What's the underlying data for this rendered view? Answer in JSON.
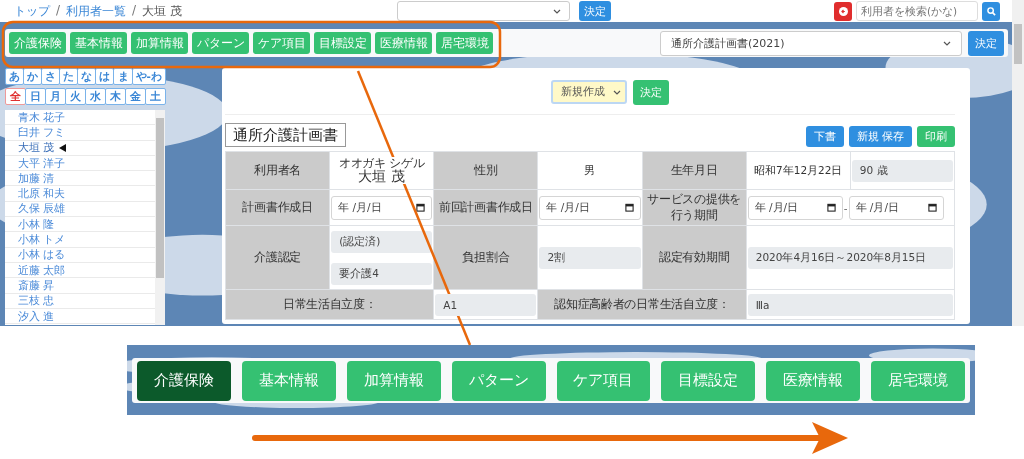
{
  "breadcrumb": [
    {
      "kind": "link",
      "label": "トップ"
    },
    {
      "kind": "separator",
      "label": "/"
    },
    {
      "kind": "link",
      "label": "利用者一覧"
    },
    {
      "kind": "separator",
      "label": "/"
    },
    {
      "kind": "current",
      "label": "大垣 茂"
    }
  ],
  "top_select": {
    "button": "決定"
  },
  "search": {
    "placeholder": "利用者を検索(かな)"
  },
  "tabs": [
    {
      "label": "介護保険",
      "selected": false
    },
    {
      "label": "基本情報",
      "selected": false
    },
    {
      "label": "加算情報",
      "selected": false
    },
    {
      "label": "パターン",
      "selected": false
    },
    {
      "label": "ケア項目",
      "selected": false
    },
    {
      "label": "目標設定",
      "selected": false
    },
    {
      "label": "医療情報",
      "selected": false
    },
    {
      "label": "居宅環境",
      "selected": false
    }
  ],
  "plan_select": {
    "value": "通所介護計画書(2021)",
    "button": "決定"
  },
  "kana_filters": [
    {
      "label": "あ",
      "selected": false
    },
    {
      "label": "か",
      "selected": false
    },
    {
      "label": "さ",
      "selected": false
    },
    {
      "label": "た",
      "selected": false
    },
    {
      "label": "な",
      "selected": false
    },
    {
      "label": "は",
      "selected": false
    },
    {
      "label": "ま",
      "selected": false
    },
    {
      "label": "や-わ",
      "selected": false
    }
  ],
  "day_filters": [
    {
      "label": "全",
      "selected": true
    },
    {
      "label": "日",
      "selected": false
    },
    {
      "label": "月",
      "selected": false
    },
    {
      "label": "火",
      "selected": false
    },
    {
      "label": "水",
      "selected": false
    },
    {
      "label": "木",
      "selected": false
    },
    {
      "label": "金",
      "selected": false
    },
    {
      "label": "土",
      "selected": false
    }
  ],
  "users": [
    {
      "name": "青木 花子",
      "selected": false
    },
    {
      "name": "臼井 フミ",
      "selected": false
    },
    {
      "name": "大垣 茂",
      "selected": true
    },
    {
      "name": "大平 洋子",
      "selected": false
    },
    {
      "name": "加藤 清",
      "selected": false
    },
    {
      "name": "北原 和夫",
      "selected": false
    },
    {
      "name": "久保 辰雄",
      "selected": false
    },
    {
      "name": "小林 隆",
      "selected": false
    },
    {
      "name": "小林 トメ",
      "selected": false
    },
    {
      "name": "小林 はる",
      "selected": false
    },
    {
      "name": "近藤 太郎",
      "selected": false
    },
    {
      "name": "斎藤 昇",
      "selected": false
    },
    {
      "name": "三枝 忠",
      "selected": false
    },
    {
      "name": "汐入 進",
      "selected": false
    }
  ],
  "mode_select": {
    "value": "新規作成",
    "button": "決定"
  },
  "form": {
    "title": "通所介護計画書",
    "actions": [
      {
        "label": "下書",
        "kind": "primary"
      },
      {
        "label": "新規 保存",
        "kind": "primary"
      },
      {
        "label": "印刷",
        "kind": "success"
      }
    ],
    "rows": [
      [
        {
          "kind": "label",
          "text": "利用者名"
        },
        {
          "kind": "name",
          "ruby": "オオガキ シゲル",
          "text": "大垣 茂"
        },
        {
          "kind": "label",
          "text": "性別"
        },
        {
          "kind": "text",
          "text": "男"
        },
        {
          "kind": "label",
          "text": "生年月日"
        },
        {
          "kind": "text",
          "text": "昭和7年12月22日"
        },
        {
          "kind": "readonly",
          "text": "90 歳"
        }
      ],
      [
        {
          "kind": "label",
          "text": "計画書作成日"
        },
        {
          "kind": "date",
          "text": "年 /月/日"
        },
        {
          "kind": "label",
          "text": "前回計画書作成日"
        },
        {
          "kind": "date",
          "text": "年 /月/日"
        },
        {
          "kind": "label",
          "lines": [
            "サービスの提供を",
            "行う期間"
          ]
        },
        {
          "kind": "date_range",
          "start": "年 /月/日",
          "separator": "-",
          "end": "年 /月/日",
          "colspan": 2
        }
      ],
      [
        {
          "kind": "label",
          "text": "介護認定"
        },
        {
          "kind": "stack",
          "values": [
            "(認定済)",
            "要介護4"
          ]
        },
        {
          "kind": "label",
          "text": "負担割合"
        },
        {
          "kind": "readonly",
          "text": "2割"
        },
        {
          "kind": "label",
          "text": "認定有効期間"
        },
        {
          "kind": "readonly",
          "text": "2020年4月16日～2020年8月15日",
          "colspan": 2
        }
      ],
      [
        {
          "kind": "label",
          "text": "日常生活自立度：",
          "colspan": 2
        },
        {
          "kind": "readonly",
          "text": "A1"
        },
        {
          "kind": "label",
          "text": "認知症高齢者の日常生活自立度：",
          "colspan": 2
        },
        {
          "kind": "readonly",
          "text": "Ⅲa",
          "colspan": 2
        }
      ]
    ]
  },
  "inset_tabs": [
    {
      "label": "介護保険",
      "selected": true
    },
    {
      "label": "基本情報",
      "selected": false
    },
    {
      "label": "加算情報",
      "selected": false
    },
    {
      "label": "パターン",
      "selected": false
    },
    {
      "label": "ケア項目",
      "selected": false
    },
    {
      "label": "目標設定",
      "selected": false
    },
    {
      "label": "医療情報",
      "selected": false
    },
    {
      "label": "居宅環境",
      "selected": false
    }
  ]
}
